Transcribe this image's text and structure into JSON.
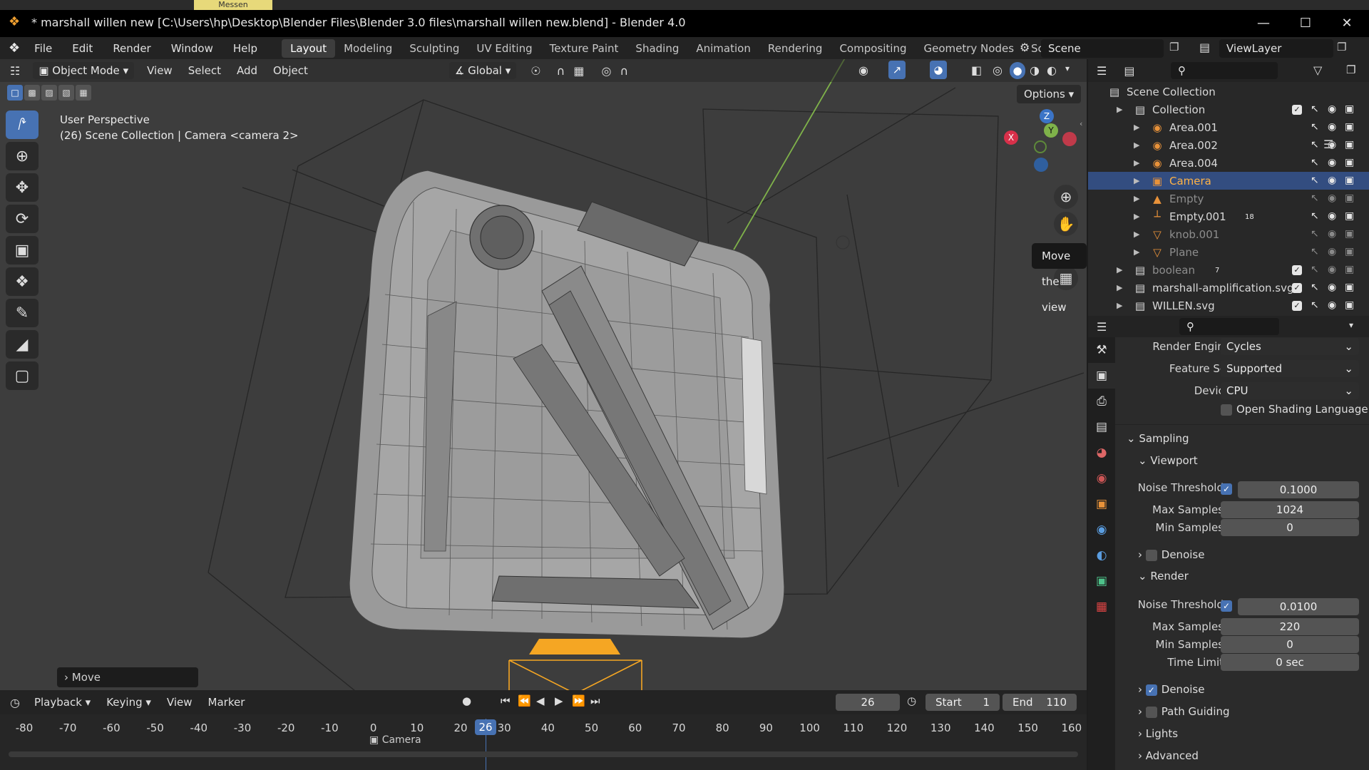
{
  "window": {
    "title": "* marshall willen new [C:\\Users\\hp\\Desktop\\Blender Files\\Blender 3.0 files\\marshall willen new.blend] - Blender 4.0",
    "taskbar_tab": "Messen",
    "controls": {
      "minimize": "—",
      "maximize": "☐",
      "close": "✕"
    }
  },
  "menu": [
    "File",
    "Edit",
    "Render",
    "Window",
    "Help"
  ],
  "workspaces": [
    "Layout",
    "Modeling",
    "Sculpting",
    "UV Editing",
    "Texture Paint",
    "Shading",
    "Animation",
    "Rendering",
    "Compositing",
    "Geometry Nodes",
    "Scripting"
  ],
  "workspace_add": "+",
  "scene": {
    "name": "Scene",
    "view_layer": "ViewLayer"
  },
  "viewport": {
    "mode": "Object Mode",
    "menus": [
      "View",
      "Select",
      "Add",
      "Object"
    ],
    "transform_orientation": "Global",
    "info_line1": "User Perspective",
    "info_line2": "(26) Scene Collection | Camera <camera 2>",
    "options": "Options",
    "last_op": "Move",
    "tooltip": "Move the view",
    "gizmo": {
      "x": "X",
      "y": "Y",
      "z": "Z"
    },
    "colors": {
      "bg": "#3d3d3d",
      "mesh": "#9a9a9a",
      "wire": "#2a2a2a",
      "y_axis": "#7fb24a",
      "x_axis": "#d8304a",
      "camera": "#f5a623"
    }
  },
  "timeline": {
    "menus": [
      "Playback",
      "Keying",
      "View",
      "Marker"
    ],
    "current_frame": "26",
    "start_label": "Start",
    "start": "1",
    "end_label": "End",
    "end": "110",
    "ticks": [
      "-80",
      "-70",
      "-60",
      "-50",
      "-40",
      "-30",
      "-20",
      "-10",
      "0",
      "10",
      "20",
      "30",
      "40",
      "50",
      "60",
      "70",
      "80",
      "90",
      "100",
      "110",
      "120",
      "130",
      "140",
      "150",
      "160"
    ],
    "camera_marker": "Camera"
  },
  "outliner": {
    "root": "Scene Collection",
    "items": [
      {
        "label": "Collection",
        "indent": 0,
        "icon": "collection-icon",
        "glyph": "▤",
        "dim": false,
        "sel": false,
        "check": true
      },
      {
        "label": "Area.001",
        "indent": 1,
        "icon": "light-icon",
        "glyph": "◉",
        "dim": false,
        "sel": false,
        "check": false
      },
      {
        "label": "Area.002",
        "indent": 1,
        "icon": "light-icon",
        "glyph": "◉",
        "dim": false,
        "sel": false,
        "check": false
      },
      {
        "label": "Area.004",
        "indent": 1,
        "icon": "light-icon",
        "glyph": "◉",
        "dim": false,
        "sel": false,
        "check": false
      },
      {
        "label": "Camera",
        "indent": 1,
        "icon": "camera-icon",
        "glyph": "▣",
        "dim": false,
        "sel": true,
        "check": false
      },
      {
        "label": "Empty",
        "indent": 1,
        "icon": "empty-icon",
        "glyph": "▲",
        "dim": true,
        "sel": false,
        "check": false
      },
      {
        "label": "Empty.001",
        "indent": 1,
        "icon": "empty-icon",
        "glyph": "┴",
        "dim": false,
        "sel": false,
        "check": false
      },
      {
        "label": "knob.001",
        "indent": 1,
        "icon": "mesh-icon",
        "glyph": "▽",
        "dim": true,
        "sel": false,
        "check": false
      },
      {
        "label": "Plane",
        "indent": 1,
        "icon": "mesh-icon",
        "glyph": "▽",
        "dim": true,
        "sel": false,
        "check": false
      },
      {
        "label": "boolean",
        "indent": 0,
        "icon": "collection-icon",
        "glyph": "▤",
        "dim": true,
        "sel": false,
        "check": true
      },
      {
        "label": "marshall-amplification.svg",
        "indent": 0,
        "icon": "collection-icon",
        "glyph": "▤",
        "dim": false,
        "sel": false,
        "check": true
      },
      {
        "label": "WILLEN.svg",
        "indent": 0,
        "icon": "collection-icon",
        "glyph": "▤",
        "dim": false,
        "sel": false,
        "check": true
      }
    ],
    "badge_empty001": "18",
    "badge_boolean": "7"
  },
  "properties": {
    "render_engine_label": "Render Engine",
    "render_engine": "Cycles",
    "feature_set_label": "Feature Set",
    "feature_set": "Supported",
    "device_label": "Device",
    "device": "CPU",
    "osl_label": "Open Shading Language",
    "sampling": "Sampling",
    "viewport_section": "Viewport",
    "vp_noise_label": "Noise Threshold",
    "vp_noise": "0.1000",
    "vp_max_label": "Max Samples",
    "vp_max": "1024",
    "vp_min_label": "Min Samples",
    "vp_min": "0",
    "denoise_label": "Denoise",
    "render_section": "Render",
    "r_noise_label": "Noise Threshold",
    "r_noise": "0.0100",
    "r_max_label": "Max Samples",
    "r_max": "220",
    "r_min_label": "Min Samples",
    "r_min": "0",
    "time_limit_label": "Time Limit",
    "time_limit": "0 sec",
    "denoise2_label": "Denoise",
    "path_guiding": "Path Guiding",
    "lights": "Lights",
    "advanced": "Advanced"
  }
}
